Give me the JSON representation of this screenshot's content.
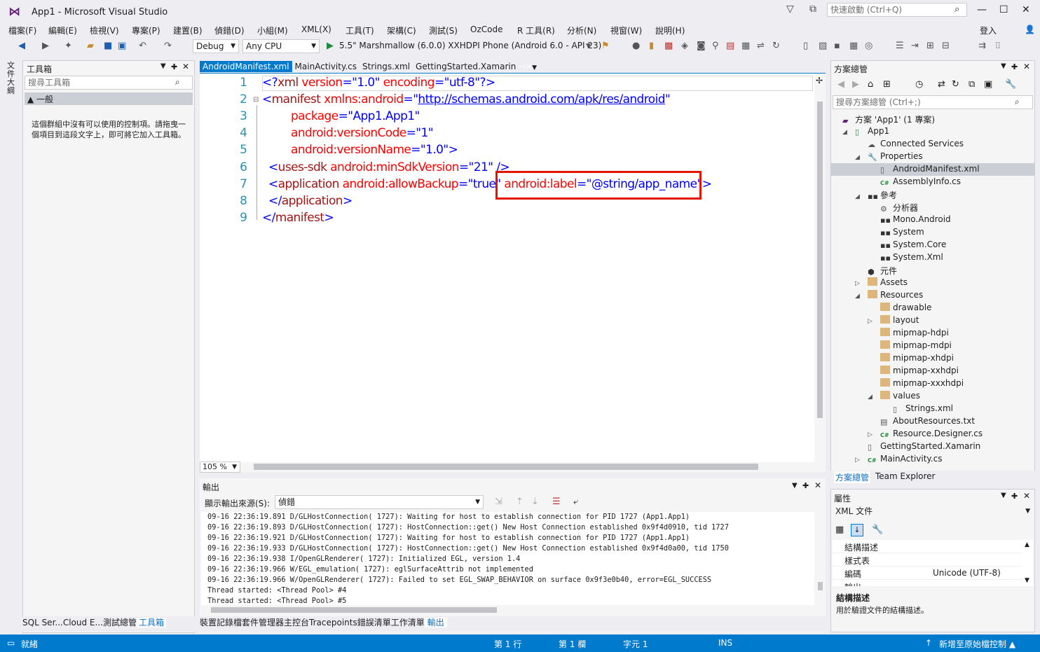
{
  "app": {
    "title": "App1 - Microsoft Visual Studio",
    "quick_launch": "快速啟動 (Ctrl+Q)",
    "sign_in": "登入"
  },
  "menu": [
    "檔案(F)",
    "編輯(E)",
    "檢視(V)",
    "專案(P)",
    "建置(B)",
    "偵錯(D)",
    "小組(M)",
    "XML(X)",
    "工具(T)",
    "架構(C)",
    "測試(S)",
    "OzCode",
    "R 工具(R)",
    "分析(N)",
    "視窗(W)",
    "說明(H)"
  ],
  "toolbar": {
    "config": "Debug",
    "platform": "Any CPU",
    "run_target": "5.5\" Marshmallow (6.0.0) XXHDPI Phone (Android 6.0 - API 23)"
  },
  "left_strip": "文件大綱",
  "toolbox": {
    "title": "工具箱",
    "search_placeholder": "搜尋工具箱",
    "group": "▲ 一般",
    "empty_msg": "這個群組中沒有可以使用的控制項。請拖曳一個項目到這段文字上，即可將它加入工具箱。",
    "tabs": [
      "SQL Ser...",
      "Cloud E...",
      "測試總管",
      "工具箱"
    ]
  },
  "editor": {
    "tabs": [
      "AndroidManifest.xml",
      "MainActivity.cs",
      "Strings.xml",
      "GettingStarted.Xamarin"
    ],
    "zoom": "105 %",
    "lines": [
      "1",
      "2",
      "3",
      "4",
      "5",
      "6",
      "7",
      "8",
      "9"
    ],
    "code": {
      "l1": [
        "<?",
        "xml",
        " version",
        "=\"",
        "1.0",
        "\"",
        " encoding",
        "=\"",
        "utf-8",
        "\"",
        "?>"
      ],
      "l2": [
        "<",
        "manifest",
        " xmlns:android",
        "=\"",
        "http://schemas.android.com/apk/res/android",
        "\""
      ],
      "l3": [
        "package",
        "=\"",
        "App1.App1",
        "\""
      ],
      "l4": [
        "android:versionCode",
        "=\"",
        "1",
        "\""
      ],
      "l5": [
        "android:versionName",
        "=\"",
        "1.0",
        "\">"
      ],
      "l6": [
        "<",
        "uses-sdk",
        " android:minSdkVersion",
        "=\"",
        "21",
        "\" />"
      ],
      "l7": [
        "<",
        "application",
        " android:allowBackup",
        "=\"",
        "true",
        "\"",
        " android:label",
        "=\"",
        "@string/app_name",
        "\">"
      ],
      "l8": [
        "</",
        "application",
        ">"
      ],
      "l9": [
        "</",
        "manifest",
        ">"
      ]
    }
  },
  "output": {
    "title": "輸出",
    "source_label": "顯示輸出來源(S):",
    "source_value": "偵錯",
    "lines": [
      "09-16 22:36:19.891 D/GLHostConnection( 1727): Waiting for host to establish connection for PID 1727 (App1.App1)",
      "09-16 22:36:19.893 D/GLHostConnection( 1727): HostConnection::get() New Host Connection established 0x9f4d0910, tid 1727",
      "09-16 22:36:19.921 D/GLHostConnection( 1727): Waiting for host to establish connection for PID 1727 (App1.App1)",
      "09-16 22:36:19.933 D/GLHostConnection( 1727): HostConnection::get() New Host Connection established 0x9f4d0a00, tid 1750",
      "09-16 22:36:19.938 I/OpenGLRenderer( 1727): Initialized EGL, version 1.4",
      "09-16 22:36:19.966 W/EGL_emulation( 1727): eglSurfaceAttrib not implemented",
      "09-16 22:36:19.966 W/OpenGLRenderer( 1727): Failed to set EGL_SWAP_BEHAVIOR on surface 0x9f3e0b40, error=EGL_SUCCESS",
      "Thread started: <Thread Pool> #4",
      "Thread started: <Thread Pool> #5"
    ],
    "tabs": [
      "裝置記錄檔",
      "套件管理器主控台",
      "Tracepoints",
      "錯誤清單",
      "工作清單",
      "輸出"
    ]
  },
  "solution": {
    "title": "方案總管",
    "search_placeholder": "搜尋方案總管 (Ctrl+;)",
    "items": [
      {
        "label": "方案 'App1' (1 專案)",
        "indent": 0,
        "exp": "",
        "icon": "solution-icon"
      },
      {
        "label": "App1",
        "indent": 1,
        "exp": "◢",
        "icon": "csproj-icon"
      },
      {
        "label": "Connected Services",
        "indent": 2,
        "exp": "",
        "icon": "connected-icon"
      },
      {
        "label": "Properties",
        "indent": 2,
        "exp": "◢",
        "icon": "wrench-icon"
      },
      {
        "label": "AndroidManifest.xml",
        "indent": 3,
        "exp": "",
        "icon": "xml-file-icon",
        "sel": true
      },
      {
        "label": "AssemblyInfo.cs",
        "indent": 3,
        "exp": "",
        "icon": "cs-file-icon"
      },
      {
        "label": "參考",
        "indent": 2,
        "exp": "◢",
        "icon": "references-icon"
      },
      {
        "label": "分析器",
        "indent": 3,
        "exp": "",
        "icon": "analyzer-icon"
      },
      {
        "label": "Mono.Android",
        "indent": 3,
        "exp": "",
        "icon": "reference-icon"
      },
      {
        "label": "System",
        "indent": 3,
        "exp": "",
        "icon": "reference-icon"
      },
      {
        "label": "System.Core",
        "indent": 3,
        "exp": "",
        "icon": "reference-icon"
      },
      {
        "label": "System.Xml",
        "indent": 3,
        "exp": "",
        "icon": "reference-icon"
      },
      {
        "label": "元件",
        "indent": 2,
        "exp": "",
        "icon": "component-icon"
      },
      {
        "label": "Assets",
        "indent": 2,
        "exp": "▷",
        "icon": "folder-icon"
      },
      {
        "label": "Resources",
        "indent": 2,
        "exp": "◢",
        "icon": "folder-icon"
      },
      {
        "label": "drawable",
        "indent": 3,
        "exp": "",
        "icon": "folder-icon"
      },
      {
        "label": "layout",
        "indent": 3,
        "exp": "▷",
        "icon": "folder-icon"
      },
      {
        "label": "mipmap-hdpi",
        "indent": 3,
        "exp": "",
        "icon": "folder-icon"
      },
      {
        "label": "mipmap-mdpi",
        "indent": 3,
        "exp": "",
        "icon": "folder-icon"
      },
      {
        "label": "mipmap-xhdpi",
        "indent": 3,
        "exp": "",
        "icon": "folder-icon"
      },
      {
        "label": "mipmap-xxhdpi",
        "indent": 3,
        "exp": "",
        "icon": "folder-icon"
      },
      {
        "label": "mipmap-xxxhdpi",
        "indent": 3,
        "exp": "",
        "icon": "folder-icon"
      },
      {
        "label": "values",
        "indent": 3,
        "exp": "◢",
        "icon": "folder-icon"
      },
      {
        "label": "Strings.xml",
        "indent": 4,
        "exp": "",
        "icon": "xml-file-icon"
      },
      {
        "label": "AboutResources.txt",
        "indent": 3,
        "exp": "",
        "icon": "text-file-icon"
      },
      {
        "label": "Resource.Designer.cs",
        "indent": 3,
        "exp": "▷",
        "icon": "cs-file-icon"
      },
      {
        "label": "GettingStarted.Xamarin",
        "indent": 2,
        "exp": "",
        "icon": "file-icon"
      },
      {
        "label": "MainActivity.cs",
        "indent": 2,
        "exp": "▷",
        "icon": "cs-file-icon"
      }
    ],
    "tabs": [
      "方案總管",
      "Team Explorer"
    ]
  },
  "properties": {
    "title": "屬性",
    "object": "XML 文件",
    "rows": [
      [
        "結構描述",
        ""
      ],
      [
        "樣式表",
        ""
      ],
      [
        "編碼",
        "Unicode (UTF-8)"
      ],
      [
        "輸出",
        ""
      ]
    ],
    "desc_title": "結構描述",
    "desc_text": "用於驗證文件的結構描述。"
  },
  "status": {
    "ready": "就緒",
    "line": "第 1 行",
    "col": "第 1 欄",
    "char": "字元 1",
    "ins": "INS",
    "publish": "新增至原始檔控制 ▲"
  },
  "colors": {
    "accent": "#007acc",
    "highlight": "#e51400"
  }
}
